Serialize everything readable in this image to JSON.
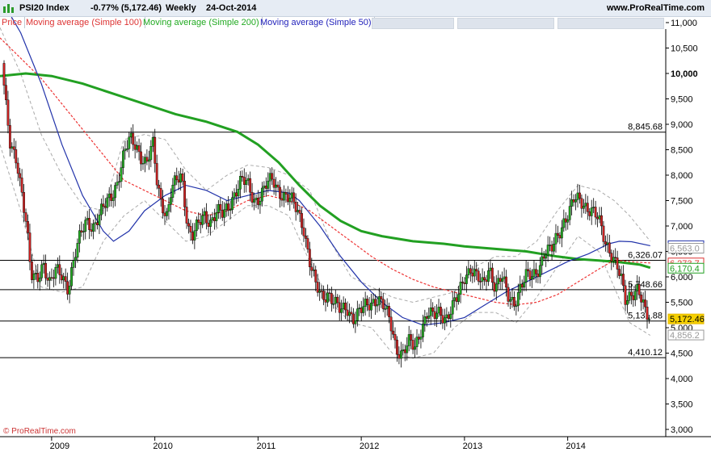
{
  "header": {
    "symbol": "PSI20 Index",
    "change": "-0.77% (5,172.46)",
    "period": "Weekly",
    "date": "24-Oct-2014",
    "site": "www.ProRealTime.com"
  },
  "watermark": "© ProRealTime.com",
  "legend": [
    {
      "label": "Price",
      "color": "#dd3333"
    },
    {
      "label": "Moving average (Simple 100)",
      "color": "#dd3333"
    },
    {
      "label": "Moving average (Simple 200)",
      "color": "#22aa22"
    },
    {
      "label": "Moving average (Simple 50)",
      "color": "#2222bb"
    }
  ],
  "colors": {
    "up_candle": "#22aa22",
    "down_candle": "#cc2222",
    "ma100": "#ee3333",
    "ma200": "#22a022",
    "ma50": "#2233aa",
    "band": "#aaaaaa",
    "level_line": "#000000"
  },
  "chart_data": {
    "type": "candlestick",
    "title": "PSI20 Index",
    "ylim": [
      3000,
      11000
    ],
    "y_ticks": [
      "11,000",
      "10,500",
      "10,000",
      "9,500",
      "9,000",
      "8,500",
      "8,000",
      "7,500",
      "7,000",
      "6,500",
      "6,000",
      "5,500",
      "5,000",
      "4,500",
      "4,000",
      "3,500",
      "3,000"
    ],
    "y_tick_values": [
      11000,
      10500,
      10000,
      9500,
      9000,
      8500,
      8000,
      7500,
      7000,
      6500,
      6000,
      5500,
      5000,
      4500,
      4000,
      3500,
      3000
    ],
    "bold_tick": "10,000",
    "x_ticks": [
      "2009",
      "2010",
      "2011",
      "2012",
      "2013",
      "2014"
    ],
    "x_tick_values": [
      2009.0,
      2010.0,
      2011.0,
      2012.0,
      2013.0,
      2014.0
    ],
    "xlim": [
      2008.5,
      2014.95
    ],
    "horizontal_levels": [
      {
        "value": 8845.68,
        "label": "8,845.68"
      },
      {
        "value": 6326.07,
        "label": "6,326.07"
      },
      {
        "value": 5748.66,
        "label": "5,748.66"
      },
      {
        "value": 5131.88,
        "label": "5,131.88"
      },
      {
        "value": 4410.12,
        "label": "4,410.12"
      }
    ],
    "price_path": [
      [
        2008.52,
        10200
      ],
      [
        2008.56,
        9300
      ],
      [
        2008.6,
        8500
      ],
      [
        2008.66,
        8300
      ],
      [
        2008.72,
        7600
      ],
      [
        2008.76,
        7000
      ],
      [
        2008.8,
        6000
      ],
      [
        2008.86,
        5900
      ],
      [
        2008.92,
        6300
      ],
      [
        2008.98,
        5900
      ],
      [
        2009.04,
        6100
      ],
      [
        2009.1,
        6000
      ],
      [
        2009.16,
        5800
      ],
      [
        2009.22,
        6400
      ],
      [
        2009.28,
        6800
      ],
      [
        2009.34,
        7100
      ],
      [
        2009.4,
        7000
      ],
      [
        2009.46,
        7200
      ],
      [
        2009.52,
        7400
      ],
      [
        2009.58,
        7600
      ],
      [
        2009.64,
        7900
      ],
      [
        2009.7,
        8400
      ],
      [
        2009.76,
        8700
      ],
      [
        2009.82,
        8600
      ],
      [
        2009.86,
        8400
      ],
      [
        2009.92,
        8200
      ],
      [
        2009.98,
        8600
      ],
      [
        2010.02,
        7900
      ],
      [
        2010.06,
        7500
      ],
      [
        2010.12,
        7200
      ],
      [
        2010.16,
        7700
      ],
      [
        2010.22,
        7900
      ],
      [
        2010.26,
        8000
      ],
      [
        2010.32,
        7000
      ],
      [
        2010.36,
        6800
      ],
      [
        2010.42,
        7000
      ],
      [
        2010.48,
        7200
      ],
      [
        2010.54,
        7100
      ],
      [
        2010.6,
        7300
      ],
      [
        2010.66,
        7200
      ],
      [
        2010.72,
        7400
      ],
      [
        2010.78,
        7700
      ],
      [
        2010.84,
        7900
      ],
      [
        2010.9,
        7800
      ],
      [
        2010.96,
        7500
      ],
      [
        2011.02,
        7600
      ],
      [
        2011.08,
        7800
      ],
      [
        2011.14,
        7900
      ],
      [
        2011.2,
        7700
      ],
      [
        2011.26,
        7600
      ],
      [
        2011.32,
        7500
      ],
      [
        2011.38,
        7300
      ],
      [
        2011.44,
        7000
      ],
      [
        2011.5,
        6300
      ],
      [
        2011.56,
        5800
      ],
      [
        2011.62,
        5600
      ],
      [
        2011.68,
        5700
      ],
      [
        2011.74,
        5500
      ],
      [
        2011.8,
        5300
      ],
      [
        2011.86,
        5400
      ],
      [
        2011.92,
        5200
      ],
      [
        2011.98,
        5300
      ],
      [
        2012.04,
        5400
      ],
      [
        2012.1,
        5500
      ],
      [
        2012.16,
        5600
      ],
      [
        2012.22,
        5400
      ],
      [
        2012.28,
        5100
      ],
      [
        2012.34,
        4600
      ],
      [
        2012.4,
        4500
      ],
      [
        2012.46,
        4700
      ],
      [
        2012.52,
        4600
      ],
      [
        2012.58,
        5000
      ],
      [
        2012.64,
        5300
      ],
      [
        2012.7,
        5200
      ],
      [
        2012.76,
        5300
      ],
      [
        2012.82,
        5200
      ],
      [
        2012.88,
        5400
      ],
      [
        2012.94,
        5600
      ],
      [
        2013.0,
        6000
      ],
      [
        2013.06,
        6200
      ],
      [
        2013.12,
        6000
      ],
      [
        2013.18,
        5800
      ],
      [
        2013.24,
        6200
      ],
      [
        2013.3,
        5800
      ],
      [
        2013.36,
        6000
      ],
      [
        2013.42,
        5600
      ],
      [
        2013.48,
        5500
      ],
      [
        2013.54,
        5800
      ],
      [
        2013.6,
        6000
      ],
      [
        2013.66,
        6000
      ],
      [
        2013.72,
        6200
      ],
      [
        2013.78,
        6500
      ],
      [
        2013.84,
        6500
      ],
      [
        2013.9,
        6800
      ],
      [
        2013.96,
        7100
      ],
      [
        2014.02,
        7300
      ],
      [
        2014.06,
        7500
      ],
      [
        2014.12,
        7500
      ],
      [
        2014.18,
        7400
      ],
      [
        2014.24,
        7300
      ],
      [
        2014.3,
        7100
      ],
      [
        2014.36,
        6700
      ],
      [
        2014.42,
        6500
      ],
      [
        2014.48,
        6200
      ],
      [
        2014.52,
        5900
      ],
      [
        2014.56,
        5500
      ],
      [
        2014.62,
        5700
      ],
      [
        2014.68,
        5800
      ],
      [
        2014.72,
        5500
      ],
      [
        2014.76,
        5200
      ],
      [
        2014.8,
        5172
      ]
    ],
    "ma200": [
      [
        2008.5,
        9950
      ],
      [
        2008.75,
        10000
      ],
      [
        2009.0,
        9950
      ],
      [
        2009.3,
        9800
      ],
      [
        2009.6,
        9600
      ],
      [
        2009.9,
        9400
      ],
      [
        2010.2,
        9200
      ],
      [
        2010.5,
        9050
      ],
      [
        2010.8,
        8850
      ],
      [
        2011.0,
        8600
      ],
      [
        2011.2,
        8250
      ],
      [
        2011.4,
        7800
      ],
      [
        2011.6,
        7400
      ],
      [
        2011.8,
        7100
      ],
      [
        2012.0,
        6900
      ],
      [
        2012.2,
        6800
      ],
      [
        2012.5,
        6700
      ],
      [
        2012.8,
        6650
      ],
      [
        2013.0,
        6600
      ],
      [
        2013.3,
        6550
      ],
      [
        2013.6,
        6500
      ],
      [
        2013.9,
        6400
      ],
      [
        2014.1,
        6350
      ],
      [
        2014.3,
        6320
      ],
      [
        2014.5,
        6290
      ],
      [
        2014.7,
        6240
      ],
      [
        2014.8,
        6180
      ]
    ],
    "ma100": [
      [
        2008.5,
        10700
      ],
      [
        2008.7,
        10300
      ],
      [
        2008.9,
        9900
      ],
      [
        2009.1,
        9400
      ],
      [
        2009.3,
        8900
      ],
      [
        2009.5,
        8400
      ],
      [
        2009.7,
        7900
      ],
      [
        2009.9,
        7700
      ],
      [
        2010.1,
        7500
      ],
      [
        2010.3,
        7300
      ],
      [
        2010.5,
        7200
      ],
      [
        2010.7,
        7300
      ],
      [
        2010.9,
        7500
      ],
      [
        2011.1,
        7600
      ],
      [
        2011.3,
        7500
      ],
      [
        2011.5,
        7300
      ],
      [
        2011.7,
        7000
      ],
      [
        2011.9,
        6700
      ],
      [
        2012.1,
        6400
      ],
      [
        2012.3,
        6150
      ],
      [
        2012.5,
        5950
      ],
      [
        2012.7,
        5800
      ],
      [
        2012.9,
        5700
      ],
      [
        2013.1,
        5600
      ],
      [
        2013.3,
        5500
      ],
      [
        2013.5,
        5450
      ],
      [
        2013.7,
        5500
      ],
      [
        2013.9,
        5650
      ],
      [
        2014.1,
        5900
      ],
      [
        2014.3,
        6150
      ],
      [
        2014.45,
        6330
      ],
      [
        2014.6,
        6300
      ],
      [
        2014.8,
        6273
      ]
    ],
    "ma50": [
      [
        2008.5,
        11500
      ],
      [
        2008.7,
        10800
      ],
      [
        2008.9,
        9800
      ],
      [
        2009.1,
        8600
      ],
      [
        2009.3,
        7600
      ],
      [
        2009.5,
        6900
      ],
      [
        2009.6,
        6700
      ],
      [
        2009.75,
        6900
      ],
      [
        2009.9,
        7300
      ],
      [
        2010.1,
        7600
      ],
      [
        2010.3,
        7800
      ],
      [
        2010.5,
        7700
      ],
      [
        2010.7,
        7500
      ],
      [
        2010.9,
        7600
      ],
      [
        2011.1,
        7700
      ],
      [
        2011.3,
        7650
      ],
      [
        2011.4,
        7500
      ],
      [
        2011.6,
        7000
      ],
      [
        2011.8,
        6400
      ],
      [
        2012.0,
        5900
      ],
      [
        2012.2,
        5500
      ],
      [
        2012.4,
        5200
      ],
      [
        2012.6,
        5050
      ],
      [
        2012.8,
        5100
      ],
      [
        2013.0,
        5200
      ],
      [
        2013.2,
        5450
      ],
      [
        2013.4,
        5700
      ],
      [
        2013.6,
        5900
      ],
      [
        2013.8,
        6100
      ],
      [
        2014.0,
        6300
      ],
      [
        2014.2,
        6450
      ],
      [
        2014.4,
        6650
      ],
      [
        2014.5,
        6700
      ],
      [
        2014.62,
        6690
      ],
      [
        2014.8,
        6613
      ]
    ],
    "band": [
      [
        2008.5,
        10900
      ],
      [
        2008.7,
        10000
      ],
      [
        2008.9,
        8800
      ],
      [
        2009.1,
        8000
      ],
      [
        2009.3,
        7400
      ],
      [
        2009.5,
        7300
      ],
      [
        2009.7,
        8700
      ],
      [
        2009.9,
        8800
      ],
      [
        2010.1,
        8700
      ],
      [
        2010.3,
        8100
      ],
      [
        2010.5,
        7700
      ],
      [
        2010.7,
        8000
      ],
      [
        2010.9,
        8200
      ],
      [
        2011.1,
        8150
      ],
      [
        2011.3,
        8000
      ],
      [
        2011.5,
        7700
      ],
      [
        2011.7,
        6700
      ],
      [
        2011.9,
        6000
      ],
      [
        2012.1,
        5800
      ],
      [
        2012.3,
        5600
      ],
      [
        2012.5,
        5500
      ],
      [
        2012.7,
        5600
      ],
      [
        2012.9,
        5700
      ],
      [
        2013.1,
        6200
      ],
      [
        2013.3,
        6400
      ],
      [
        2013.5,
        6400
      ],
      [
        2013.7,
        6700
      ],
      [
        2013.9,
        7300
      ],
      [
        2014.1,
        7800
      ],
      [
        2014.3,
        7700
      ],
      [
        2014.45,
        7500
      ],
      [
        2014.6,
        7200
      ],
      [
        2014.8,
        6700
      ]
    ],
    "band_low": [
      [
        2008.5,
        8600
      ],
      [
        2008.7,
        7300
      ],
      [
        2008.9,
        5800
      ],
      [
        2009.1,
        5700
      ],
      [
        2009.3,
        5800
      ],
      [
        2009.5,
        6700
      ],
      [
        2009.7,
        7200
      ],
      [
        2009.9,
        7500
      ],
      [
        2010.1,
        7100
      ],
      [
        2010.3,
        6700
      ],
      [
        2010.5,
        6800
      ],
      [
        2010.7,
        7100
      ],
      [
        2010.9,
        7400
      ],
      [
        2011.1,
        7400
      ],
      [
        2011.3,
        7200
      ],
      [
        2011.5,
        6300
      ],
      [
        2011.7,
        5500
      ],
      [
        2011.9,
        5100
      ],
      [
        2012.1,
        5000
      ],
      [
        2012.3,
        4500
      ],
      [
        2012.5,
        4400
      ],
      [
        2012.7,
        4500
      ],
      [
        2012.9,
        5000
      ],
      [
        2013.1,
        5300
      ],
      [
        2013.3,
        5300
      ],
      [
        2013.5,
        5100
      ],
      [
        2013.7,
        5600
      ],
      [
        2013.9,
        6200
      ],
      [
        2014.1,
        6800
      ],
      [
        2014.3,
        6500
      ],
      [
        2014.45,
        5800
      ],
      [
        2014.6,
        5100
      ],
      [
        2014.8,
        4850
      ]
    ],
    "price_labels": [
      {
        "value": 6612.8,
        "label": "6,612.8",
        "color": "#2233aa"
      },
      {
        "value": 6563.0,
        "label": "6,563.0",
        "color": "#999999"
      },
      {
        "value": 6273.7,
        "label": "6,273.7",
        "color": "#dd3333"
      },
      {
        "value": 6170.4,
        "label": "6,170.4",
        "color": "#22a022"
      },
      {
        "value": 5172.46,
        "label": "5,172.46",
        "color": "#e8b800"
      },
      {
        "value": 4856.2,
        "label": "4,856.2",
        "color": "#999999"
      }
    ]
  }
}
